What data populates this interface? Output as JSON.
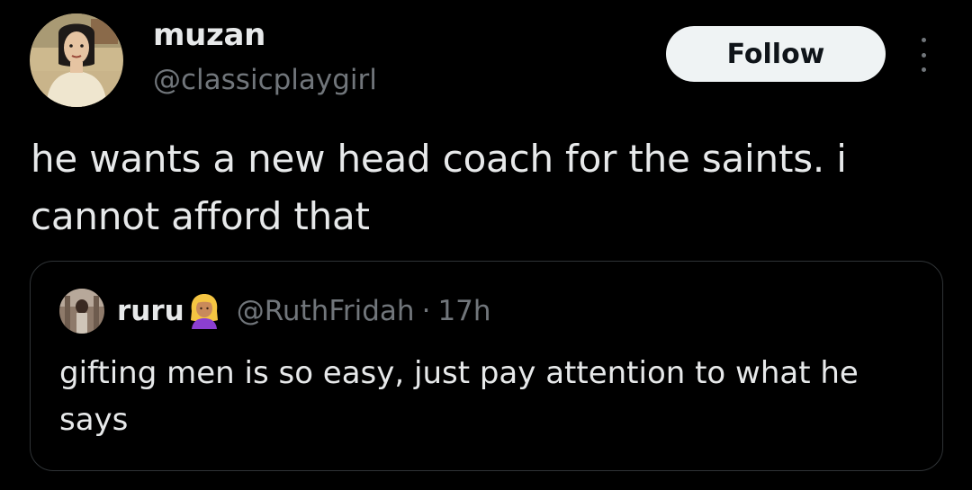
{
  "tweet": {
    "author": {
      "display_name": "muzan",
      "handle": "@classicplaygirl",
      "avatar_icon": "cartoon-woman-avatar"
    },
    "follow_label": "Follow",
    "more_icon": "more-vertical-icon",
    "text": "he wants a new head coach for the saints. i cannot afford that"
  },
  "quote": {
    "author": {
      "display_name": "ruru",
      "emoji": "woman-blond-hair-emoji",
      "handle": "@RuthFridah",
      "separator": "·",
      "time": "17h"
    },
    "text": "gifting men is so easy, just pay attention to what he says"
  },
  "colors": {
    "background": "#000000",
    "primary_text": "#e7e9ea",
    "secondary_text": "#71767b",
    "border": "#2f3336",
    "follow_button_bg": "#eff3f4",
    "follow_button_text": "#0f1419"
  }
}
